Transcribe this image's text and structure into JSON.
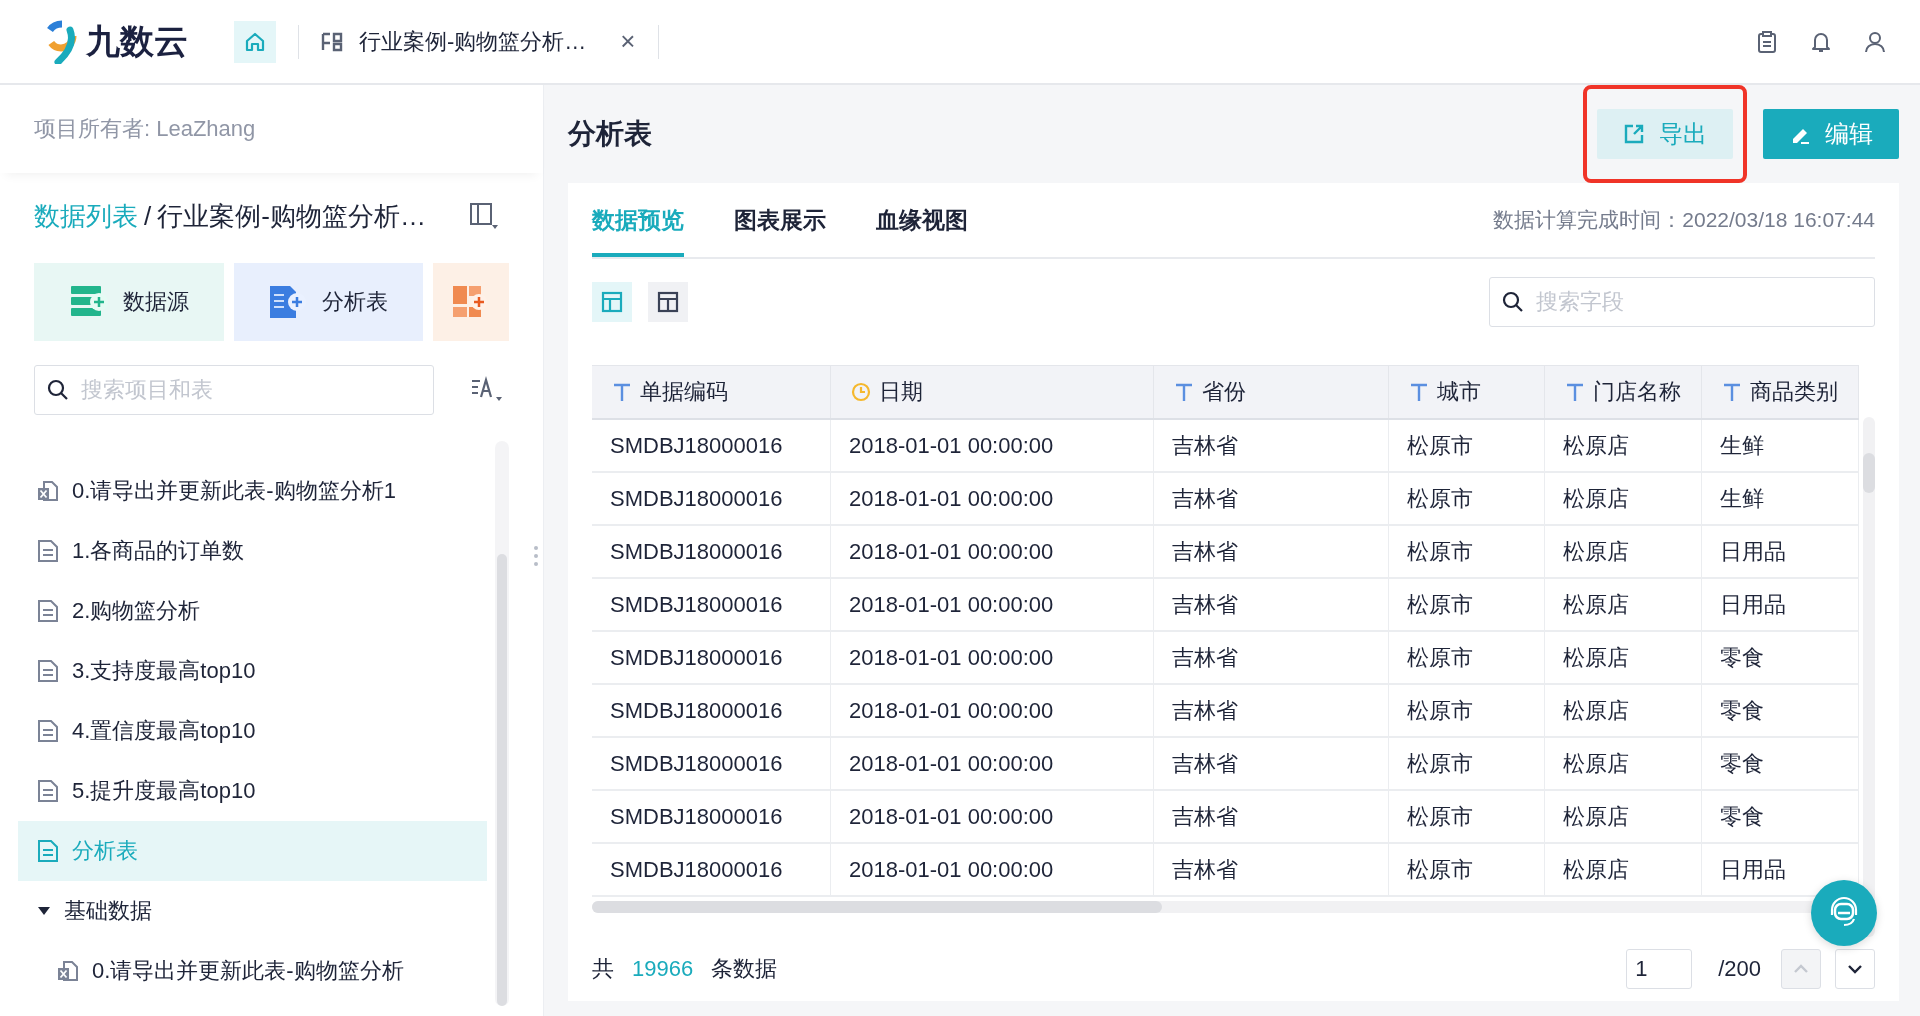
{
  "header": {
    "logo_text": "九数云",
    "tabs": [
      {
        "label": "行业案例-购物篮分析…",
        "close": "×"
      }
    ]
  },
  "sidebar": {
    "owner": "项目所有者: LeaZhang",
    "breadcrumb": {
      "root": "数据列表",
      "separator": "/",
      "current": "行业案例-购物篮分析…"
    },
    "quick_actions": [
      {
        "kind": "datasource",
        "label": "数据源"
      },
      {
        "kind": "analysis",
        "label": "分析表"
      },
      {
        "kind": "dashboard"
      }
    ],
    "search": {
      "placeholder": "搜索项目和表"
    },
    "tree": [
      {
        "kind": "excel",
        "label": "0.请导出并更新此表-购物篮分析1",
        "selected": false
      },
      {
        "kind": "table",
        "label": "1.各商品的订单数",
        "selected": false
      },
      {
        "kind": "table",
        "label": "2.购物篮分析",
        "selected": false
      },
      {
        "kind": "table",
        "label": "3.支持度最高top10",
        "selected": false
      },
      {
        "kind": "table",
        "label": "4.置信度最高top10",
        "selected": false
      },
      {
        "kind": "table",
        "label": "5.提升度最高top10",
        "selected": false
      },
      {
        "kind": "table",
        "label": "分析表",
        "selected": true
      },
      {
        "kind": "folder",
        "label": "基础数据",
        "expanded": true,
        "children": [
          {
            "kind": "excel",
            "label": "0.请导出并更新此表-购物篮分析",
            "selected": false
          }
        ]
      }
    ]
  },
  "main": {
    "title": "分析表",
    "buttons": [
      {
        "kind": "export",
        "label": "导出"
      },
      {
        "kind": "edit",
        "label": "编辑"
      }
    ],
    "tabs": [
      {
        "label": "数据预览",
        "selected": true
      },
      {
        "label": "图表展示",
        "selected": false
      },
      {
        "label": "血缘视图",
        "selected": false
      }
    ],
    "computed_time": "数据计算完成时间：2022/03/18 16:07:44",
    "view_toggles": [
      {
        "selected": true
      },
      {
        "selected": false
      }
    ],
    "search": {
      "placeholder": "搜索字段"
    },
    "table": {
      "columns": [
        {
          "kind": "text",
          "label": "单据编码"
        },
        {
          "kind": "date",
          "label": "日期"
        },
        {
          "kind": "text",
          "label": "省份"
        },
        {
          "kind": "text",
          "label": "城市"
        },
        {
          "kind": "text",
          "label": "门店名称"
        },
        {
          "kind": "text",
          "label": "商品类别"
        }
      ],
      "rows": [
        [
          "SMDBJ18000016",
          "2018-01-01 00:00:00",
          "吉林省",
          "松原市",
          "松原店",
          "生鲜"
        ],
        [
          "SMDBJ18000016",
          "2018-01-01 00:00:00",
          "吉林省",
          "松原市",
          "松原店",
          "生鲜"
        ],
        [
          "SMDBJ18000016",
          "2018-01-01 00:00:00",
          "吉林省",
          "松原市",
          "松原店",
          "日用品"
        ],
        [
          "SMDBJ18000016",
          "2018-01-01 00:00:00",
          "吉林省",
          "松原市",
          "松原店",
          "日用品"
        ],
        [
          "SMDBJ18000016",
          "2018-01-01 00:00:00",
          "吉林省",
          "松原市",
          "松原店",
          "零食"
        ],
        [
          "SMDBJ18000016",
          "2018-01-01 00:00:00",
          "吉林省",
          "松原市",
          "松原店",
          "零食"
        ],
        [
          "SMDBJ18000016",
          "2018-01-01 00:00:00",
          "吉林省",
          "松原市",
          "松原店",
          "零食"
        ],
        [
          "SMDBJ18000016",
          "2018-01-01 00:00:00",
          "吉林省",
          "松原市",
          "松原店",
          "零食"
        ],
        [
          "SMDBJ18000016",
          "2018-01-01 00:00:00",
          "吉林省",
          "松原市",
          "松原店",
          "日用品"
        ]
      ]
    },
    "footer": {
      "prefix": "共",
      "total": "19966",
      "suffix": "条数据",
      "page": "1",
      "pages": "/200"
    }
  }
}
